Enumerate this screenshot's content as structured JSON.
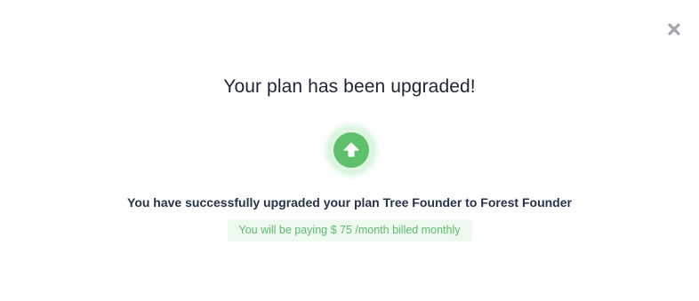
{
  "dialog": {
    "close_icon": "close-icon",
    "title": "Your plan has been upgraded!",
    "badge_icon": "upgrade-arrow-icon",
    "message": "You have successfully upgraded your plan Tree Founder to Forest Founder",
    "billing_note": "You will be paying $ 75 /month billed monthly"
  },
  "colors": {
    "accent_green": "#5fc06b",
    "billing_bg": "#eef9f0",
    "billing_text": "#5dbb6b",
    "title_text": "#1d2433",
    "close_icon": "#a3a7ad"
  }
}
